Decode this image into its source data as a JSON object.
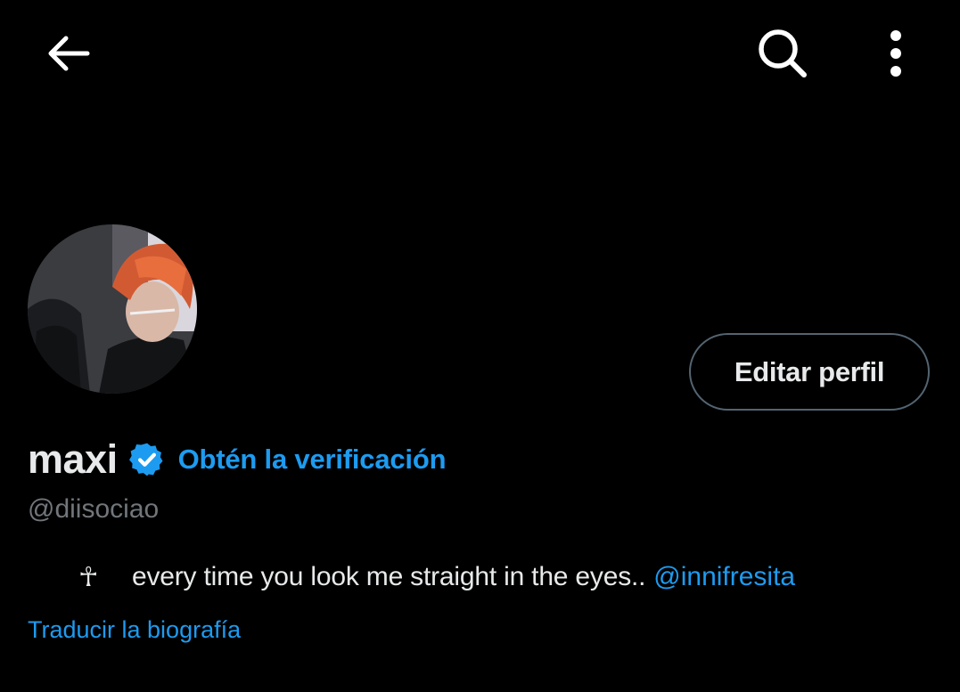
{
  "header": {
    "back_icon": "arrow-left-icon",
    "search_icon": "search-icon",
    "more_icon": "more-vertical-icon"
  },
  "profile": {
    "avatar_icon": "avatar-photo",
    "display_name": "maxi",
    "verified_icon": "verified-badge-icon",
    "get_verified_label": "Obtén la verificación",
    "handle": "@diisociao",
    "bio_symbol": "☥",
    "bio_text": "every time you look me straight in the eyes..",
    "bio_mention": "@innifresita",
    "translate_label": "Traducir la biografía"
  },
  "actions": {
    "edit_profile_label": "Editar perfil"
  },
  "colors": {
    "background": "#000000",
    "text": "#e7e9ea",
    "secondary_text": "#71767b",
    "accent": "#1d9bf0",
    "button_border": "#536471"
  }
}
